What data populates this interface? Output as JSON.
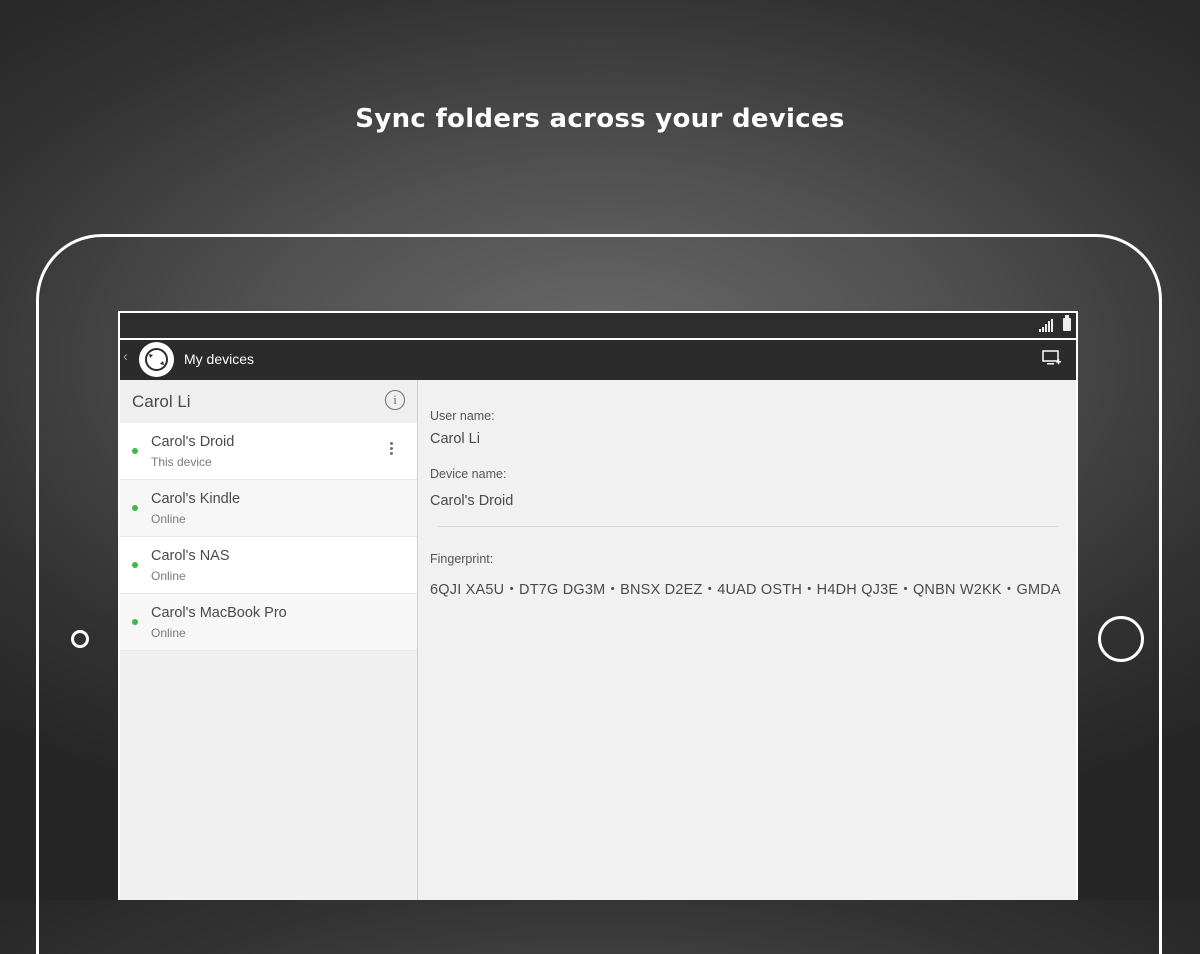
{
  "headline": "Sync folders across your devices",
  "app": {
    "title": "My devices",
    "back_icon": "chevron-left-icon",
    "logo_icon": "sync-logo-icon",
    "add_device_icon": "add-device-icon"
  },
  "sidebar": {
    "user_name": "Carol Li",
    "info_icon": "info-icon",
    "devices": [
      {
        "name": "Carol's Droid",
        "status": "This device",
        "status_color": "#3fb94b"
      },
      {
        "name": "Carol's Kindle",
        "status": "Online",
        "status_color": "#3fb94b"
      },
      {
        "name": "Carol's NAS",
        "status": "Online",
        "status_color": "#3fb94b"
      },
      {
        "name": "Carol's MacBook Pro",
        "status": "Online",
        "status_color": "#3fb94b"
      }
    ]
  },
  "details": {
    "user_name_label": "User name:",
    "user_name_value": "Carol Li",
    "device_name_label": "Device name:",
    "device_name_value": "Carol's Droid",
    "fingerprint_label": "Fingerprint:",
    "fingerprint_value": "6QJI XA5U・DT7G DG3M・BNSX D2EZ・4UAD OSTH・H4DH QJ3E・QNBN W2KK・GMDA"
  },
  "colors": {
    "accent_online": "#3fb94b",
    "actionbar": "#2b2b2b"
  }
}
